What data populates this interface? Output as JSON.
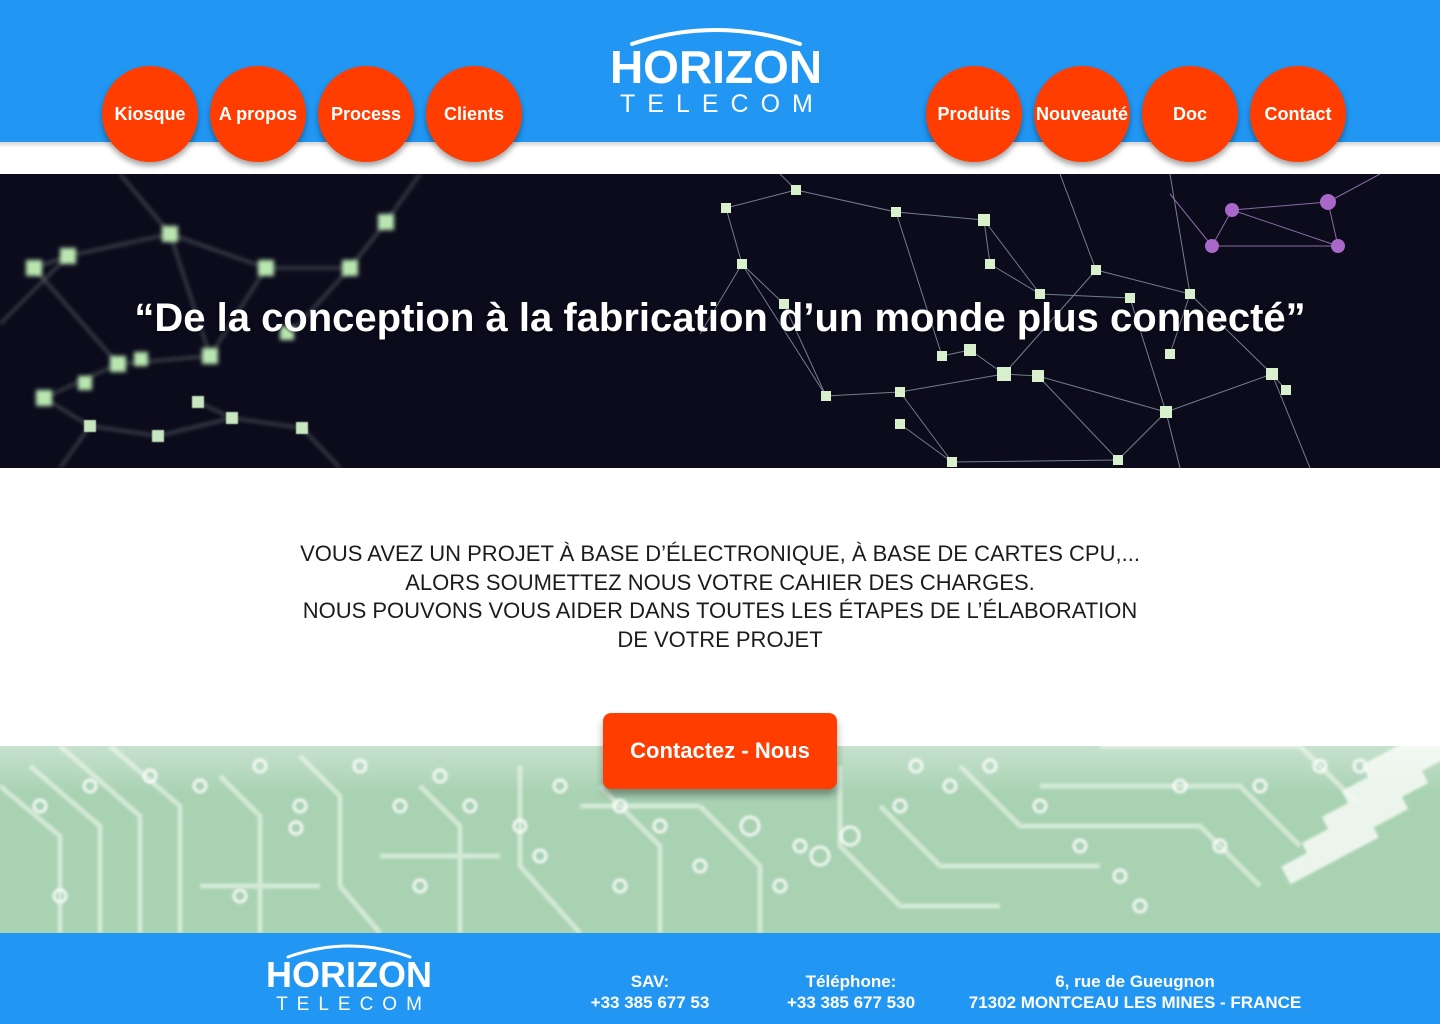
{
  "brand": {
    "name_top": "HORIZON",
    "name_bottom": "TELECOM"
  },
  "nav_left": [
    {
      "label": "Kiosque"
    },
    {
      "label": "A propos"
    },
    {
      "label": "Process"
    },
    {
      "label": "Clients"
    }
  ],
  "nav_right": [
    {
      "label": "Produits"
    },
    {
      "label": "Nouveauté"
    },
    {
      "label": "Doc"
    },
    {
      "label": "Contact"
    }
  ],
  "hero": {
    "quote": "“De la conception à la fabrication d’un monde plus connecté”"
  },
  "intro": {
    "lines": [
      "VOUS AVEZ UN PROJET À BASE D’ÉLECTRONIQUE, À BASE DE CARTES CPU,...",
      "ALORS SOUMETTEZ NOUS VOTRE CAHIER DES CHARGES.",
      "NOUS POUVONS VOUS AIDER DANS TOUTES LES ÉTAPES DE L’ÉLABORATION",
      "DE VOTRE PROJET"
    ]
  },
  "cta": {
    "label": "Contactez - Nous"
  },
  "footer": {
    "sav_label": "SAV:",
    "sav_phone": "+33 385 677 53",
    "tel_label": "Téléphone:",
    "tel_phone": "+33 385 677 530",
    "address_line1": "6, rue de Gueugnon",
    "address_line2": "71302 MONTCEAU LES MINES - FRANCE"
  },
  "colors": {
    "primary_blue": "#2196f3",
    "accent_orange": "#ff3d00",
    "hero_bg": "#0b0b1c",
    "board_green": "#a9d2b3"
  }
}
